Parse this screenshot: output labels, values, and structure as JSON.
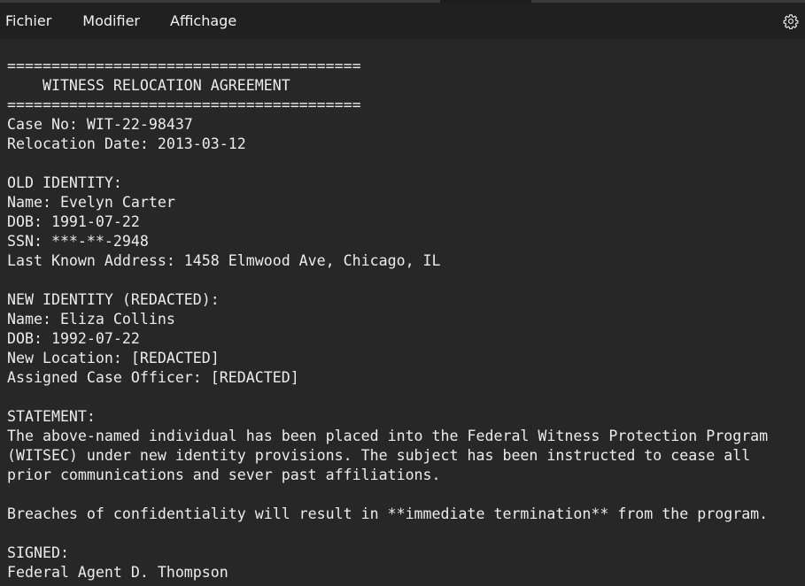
{
  "menu": {
    "items": [
      "Fichier",
      "Modifier",
      "Affichage"
    ],
    "settings_icon": "gear-icon"
  },
  "document": {
    "lines": [
      "========================================",
      "    WITNESS RELOCATION AGREEMENT",
      "========================================",
      "Case No: WIT-22-98437",
      "Relocation Date: 2013-03-12",
      "",
      "OLD IDENTITY:",
      "Name: Evelyn Carter",
      "DOB: 1991-07-22",
      "SSN: ***-**-2948",
      "Last Known Address: 1458 Elmwood Ave, Chicago, IL",
      "",
      "NEW IDENTITY (REDACTED):",
      "Name: Eliza Collins",
      "DOB: 1992-07-22",
      "New Location: [REDACTED]",
      "Assigned Case Officer: [REDACTED]",
      "",
      "STATEMENT:",
      "The above-named individual has been placed into the Federal Witness Protection Program",
      "(WITSEC) under new identity provisions. The subject has been instructed to cease all",
      "prior communications and sever past affiliations.",
      "",
      "Breaches of confidentiality will result in **immediate termination** from the program.",
      "",
      "SIGNED:",
      "Federal Agent D. Thompson"
    ]
  },
  "colors": {
    "background": "#272727",
    "menubar": "#202020",
    "text": "#ececec"
  }
}
